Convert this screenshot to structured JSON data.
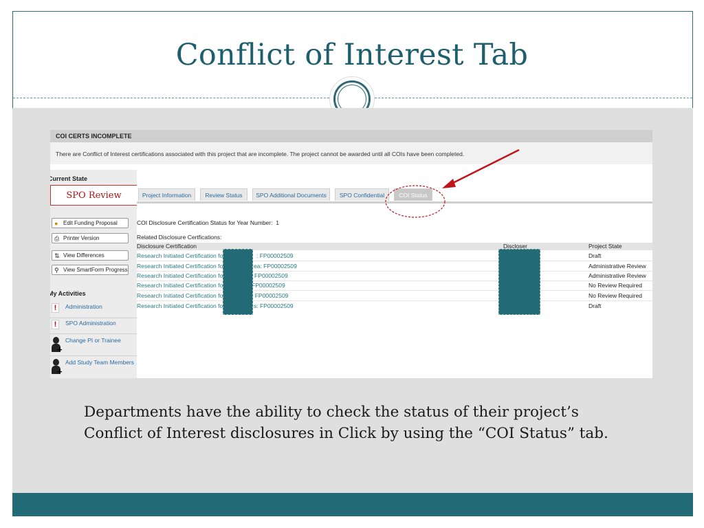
{
  "slide": {
    "title": "Conflict of Interest Tab",
    "caption": "Departments have the ability to check the status of their project’s Conflict of Interest disclosures in Click by using the “COI Status” tab.",
    "colors": {
      "teal": "#226a76",
      "title": "#1f5f6d",
      "annotation_red": "#c0141c"
    }
  },
  "app": {
    "coi_header": "COI CERTS INCOMPLETE",
    "coi_message": "There are Conflict of Interest certifications associated with this project that are incomplete.  The project cannot be awarded until all COIs have been completed.",
    "current_state_label": "Current State",
    "current_state_value": "SPO Review",
    "side_buttons": [
      {
        "label": "Edit Funding Proposal",
        "icon": "pencil-icon"
      },
      {
        "label": "Printer Version",
        "icon": "printer-icon"
      },
      {
        "label": "View Differences",
        "icon": "compare-icon"
      },
      {
        "label": "View SmartForm Progress",
        "icon": "magnifier-icon"
      }
    ],
    "my_activities_label": "My Activities",
    "activities": [
      {
        "label": "Administration",
        "icon": "exclamation-icon"
      },
      {
        "label": "SPO Administration",
        "icon": "exclamation-icon"
      },
      {
        "label": "Change PI or Trainee",
        "icon": "add-person-icon"
      },
      {
        "label": "Add Study Team Members",
        "icon": "add-person-icon"
      }
    ],
    "tabs": [
      {
        "label": "Project Information"
      },
      {
        "label": "Review Status"
      },
      {
        "label": "SPO Additional Documents"
      },
      {
        "label": "SPO Confidential"
      },
      {
        "label": "COI Status"
      }
    ],
    "active_tab": "COI Status",
    "status_label": "COI Disclosure Certification Status for Year Number:",
    "year_number": "1",
    "related_label": "Related Disclosure Certfications:",
    "columns": [
      "Disclosure Certification",
      "Discloser",
      "Project State"
    ],
    "rows": [
      {
        "cert_prefix": "Research Initiated Certification for",
        "cert_suffix": ": FP00002509",
        "state": "Draft"
      },
      {
        "cert_prefix": "Research Initiated Certification for",
        "cert_suffix": "ea: FP00002509",
        "state": "Administrative Review"
      },
      {
        "cert_prefix": "Research Initiated Certification for",
        "cert_suffix": "FP00002509",
        "state": "Administrative Review"
      },
      {
        "cert_prefix": "Research Initiated Certification for",
        "cert_suffix": "FP00002509",
        "state": "No Review Required"
      },
      {
        "cert_prefix": "Research Initiated Certification for",
        "cert_suffix": ": FP00002509",
        "state": "No Review Required"
      },
      {
        "cert_prefix": "Research Initiated Certification for",
        "cert_suffix": "s: FP00002509",
        "state": "Draft"
      }
    ]
  }
}
